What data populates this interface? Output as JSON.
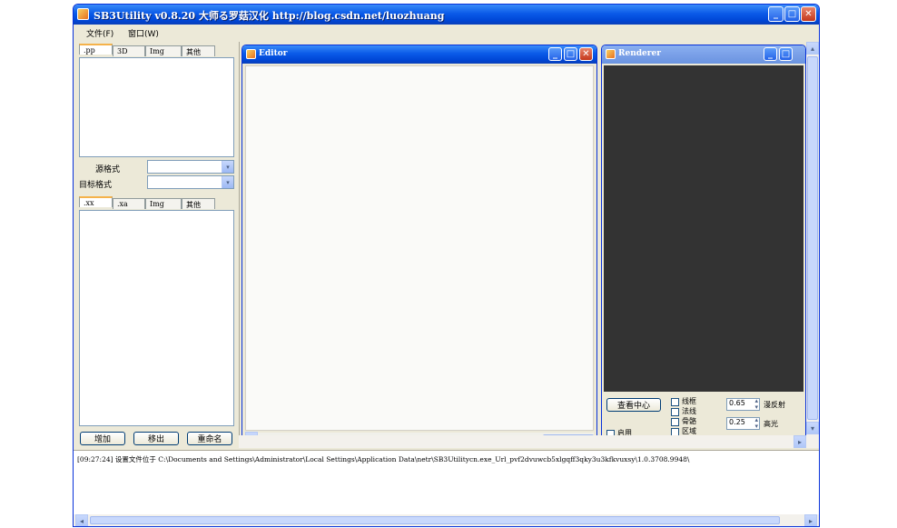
{
  "window": {
    "title": "SB3Utility v0.8.20  大师る罗菇汉化  http://blog.csdn.net/luozhuang",
    "minimize": "_",
    "maximize": "□",
    "close": "✕"
  },
  "menu": {
    "file": "文件(F)",
    "window": "窗口(W)"
  },
  "left_panel": {
    "top_tabs": [
      ".pp",
      "3D",
      "Img",
      "其他"
    ],
    "source_format_label": "源格式",
    "target_format_label": "目标格式",
    "source_format_value": "",
    "target_format_value": "",
    "bottom_tabs": [
      ".xx",
      ".xa",
      "Img",
      "其他"
    ],
    "add_button": "增加",
    "remove_button": "移出",
    "rename_button": "重命名"
  },
  "editor": {
    "title": "Editor"
  },
  "renderer": {
    "title": "Renderer",
    "view_center_button": "查看中心",
    "checkbox_wireframe": "线框",
    "checkbox_normals": "法线",
    "checkbox_bones": "骨骼",
    "checkbox_region": "区域",
    "checkbox_enable": "启用",
    "diffuse_value": "0.65",
    "diffuse_label": "漫反射",
    "specular_value": "0.25",
    "specular_label": "高光"
  },
  "log": {
    "line1": "[09:27:24] 设置文件位于 C:\\Documents and Settings\\Administrator\\Local Settings\\Application Data\\netr\\SB3Utilitycn.exe_Url_pvf2dvuwcb5xlgqff3qky3u3kfkvuxsy\\1.0.3708.9948\\"
  },
  "icons": {
    "dropdown": "▾",
    "spin_up": "▴",
    "spin_down": "▾",
    "left": "◂",
    "right": "▸",
    "up": "▴",
    "down": "▾"
  }
}
